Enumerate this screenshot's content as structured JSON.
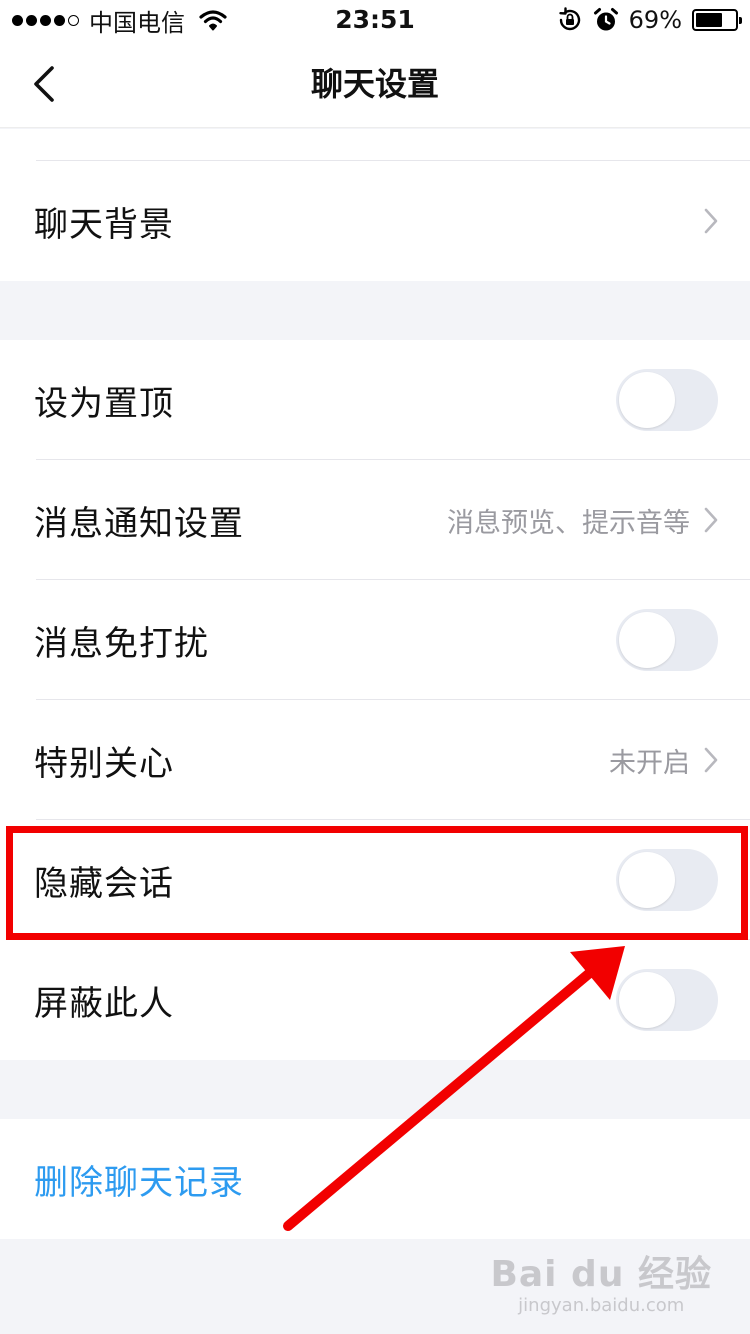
{
  "status_bar": {
    "carrier": "中国电信",
    "time": "23:51",
    "battery_percent": "69%",
    "battery_level": 0.69,
    "icons": [
      "signal-dots",
      "wifi-icon",
      "rotation-lock-icon",
      "alarm-icon",
      "battery-icon"
    ]
  },
  "nav": {
    "back_icon": "chevron-left-icon",
    "title": "聊天设置"
  },
  "group1": {
    "chat_background_label": "聊天背景"
  },
  "group2": {
    "pin_label": "设为置顶",
    "pin_on": false,
    "notify_label": "消息通知设置",
    "notify_value": "消息预览、提示音等",
    "dnd_label": "消息免打扰",
    "dnd_on": false,
    "special_label": "特别关心",
    "special_value": "未开启",
    "hide_label": "隐藏会话",
    "hide_on": false,
    "block_label": "屏蔽此人",
    "block_on": false
  },
  "group3": {
    "delete_label": "删除聊天记录"
  },
  "colors": {
    "annotation_red": "#f20000",
    "link_blue": "#2d9bf0",
    "toggle_off": "#e8ebf2"
  },
  "watermark": {
    "logo": "Bai du 经验",
    "url": "jingyan.baidu.com"
  }
}
